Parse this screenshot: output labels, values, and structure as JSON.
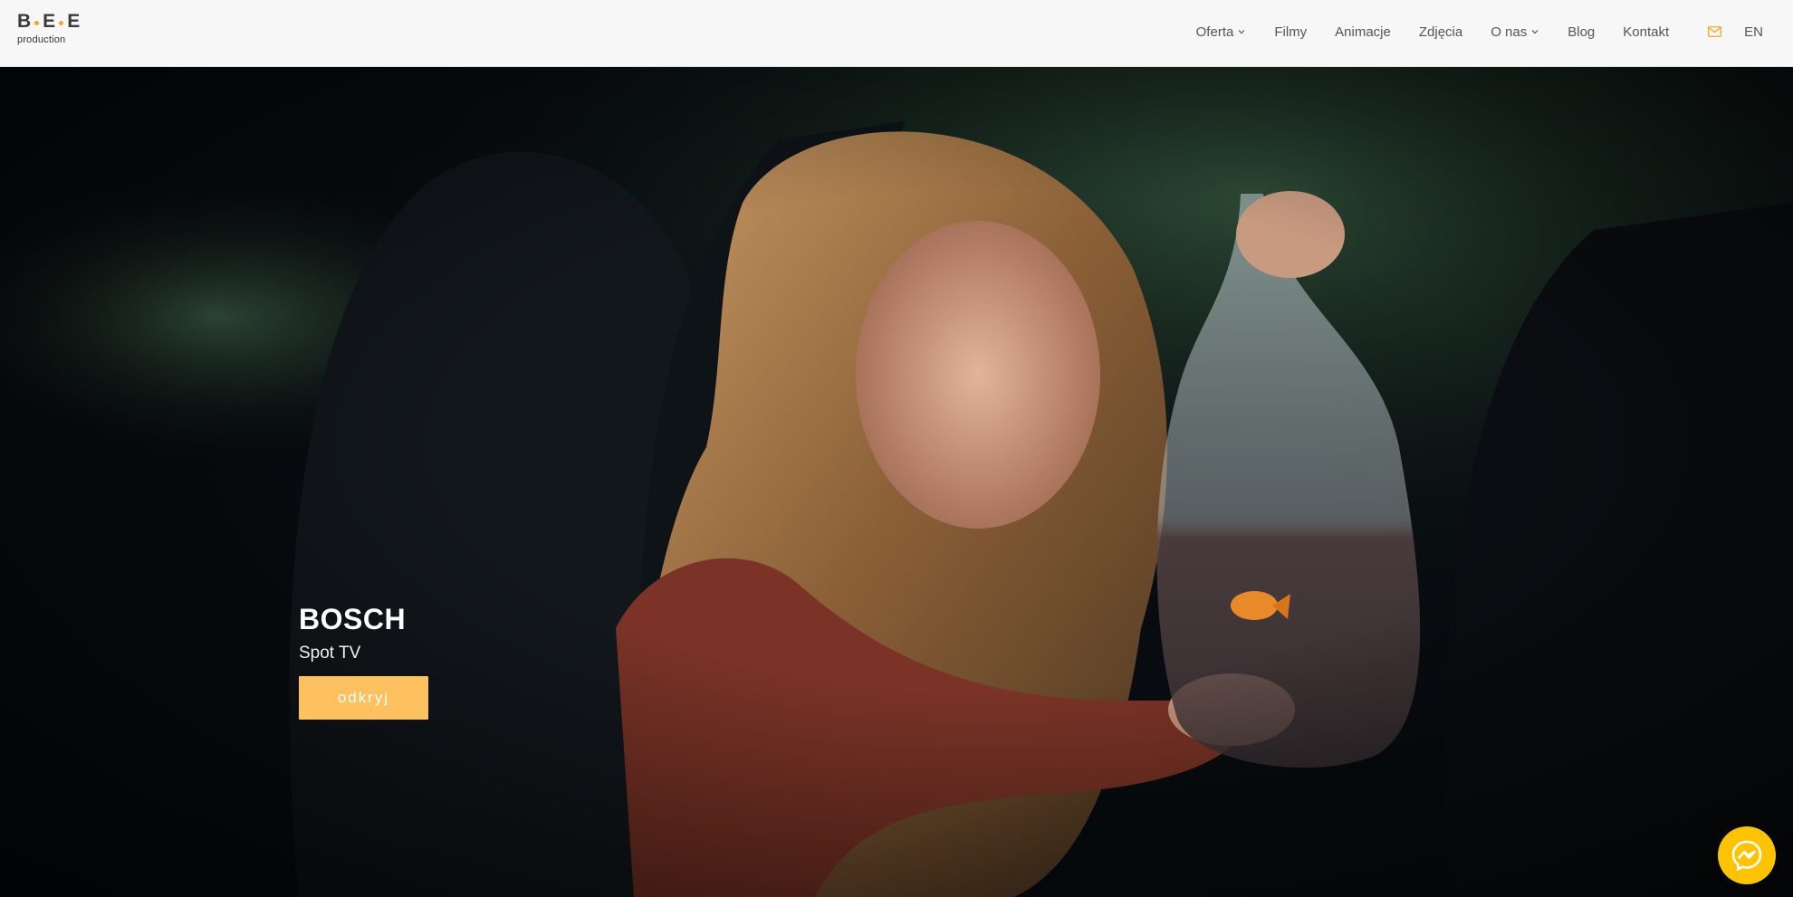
{
  "brand": {
    "logo_letters": [
      "B",
      "E",
      "E"
    ],
    "logo_subtitle": "production",
    "accent_color": "#f5a623"
  },
  "nav": {
    "items": [
      {
        "label": "Oferta",
        "has_dropdown": true
      },
      {
        "label": "Filmy",
        "has_dropdown": false
      },
      {
        "label": "Animacje",
        "has_dropdown": false
      },
      {
        "label": "Zdjęcia",
        "has_dropdown": false
      },
      {
        "label": "O nas",
        "has_dropdown": true
      },
      {
        "label": "Blog",
        "has_dropdown": false
      },
      {
        "label": "Kontakt",
        "has_dropdown": false
      }
    ],
    "mail_icon": "envelope-icon",
    "language": "EN"
  },
  "hero": {
    "title": "BOSCH",
    "subtitle": "Spot TV",
    "button_label": "odkryj",
    "button_color": "#fdc160"
  },
  "messenger": {
    "icon": "messenger-icon",
    "color": "#ffc300"
  }
}
